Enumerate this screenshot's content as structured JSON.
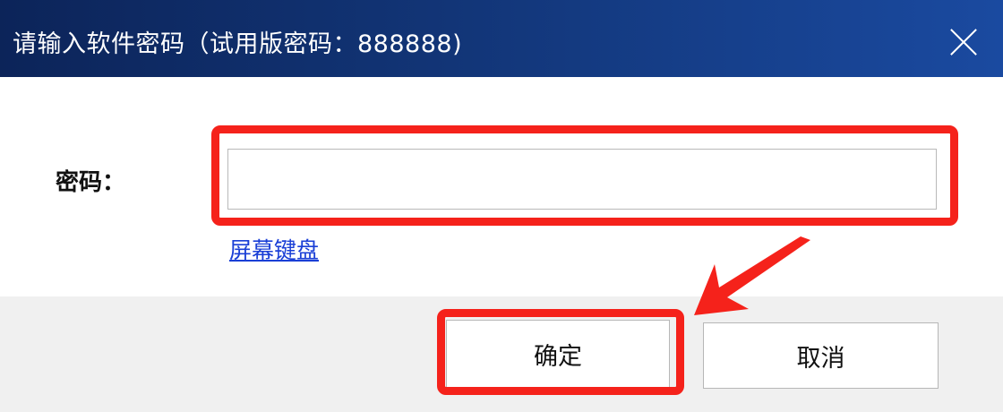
{
  "dialog": {
    "title": "请输入软件密码（试用版密码：888888)"
  },
  "form": {
    "password_label": "密码：",
    "password_value": "",
    "onscreen_keyboard_link": "屏幕键盘"
  },
  "buttons": {
    "ok_label": "确定",
    "cancel_label": "取消"
  },
  "colors": {
    "titlebar_dark": "#0c2459",
    "titlebar_light": "#1a4aa0",
    "highlight": "#f5221b",
    "link": "#1a3fd6",
    "footer": "#f0f0f0"
  },
  "icons": {
    "close": "close-icon",
    "annotation": "arrow-pointer"
  }
}
